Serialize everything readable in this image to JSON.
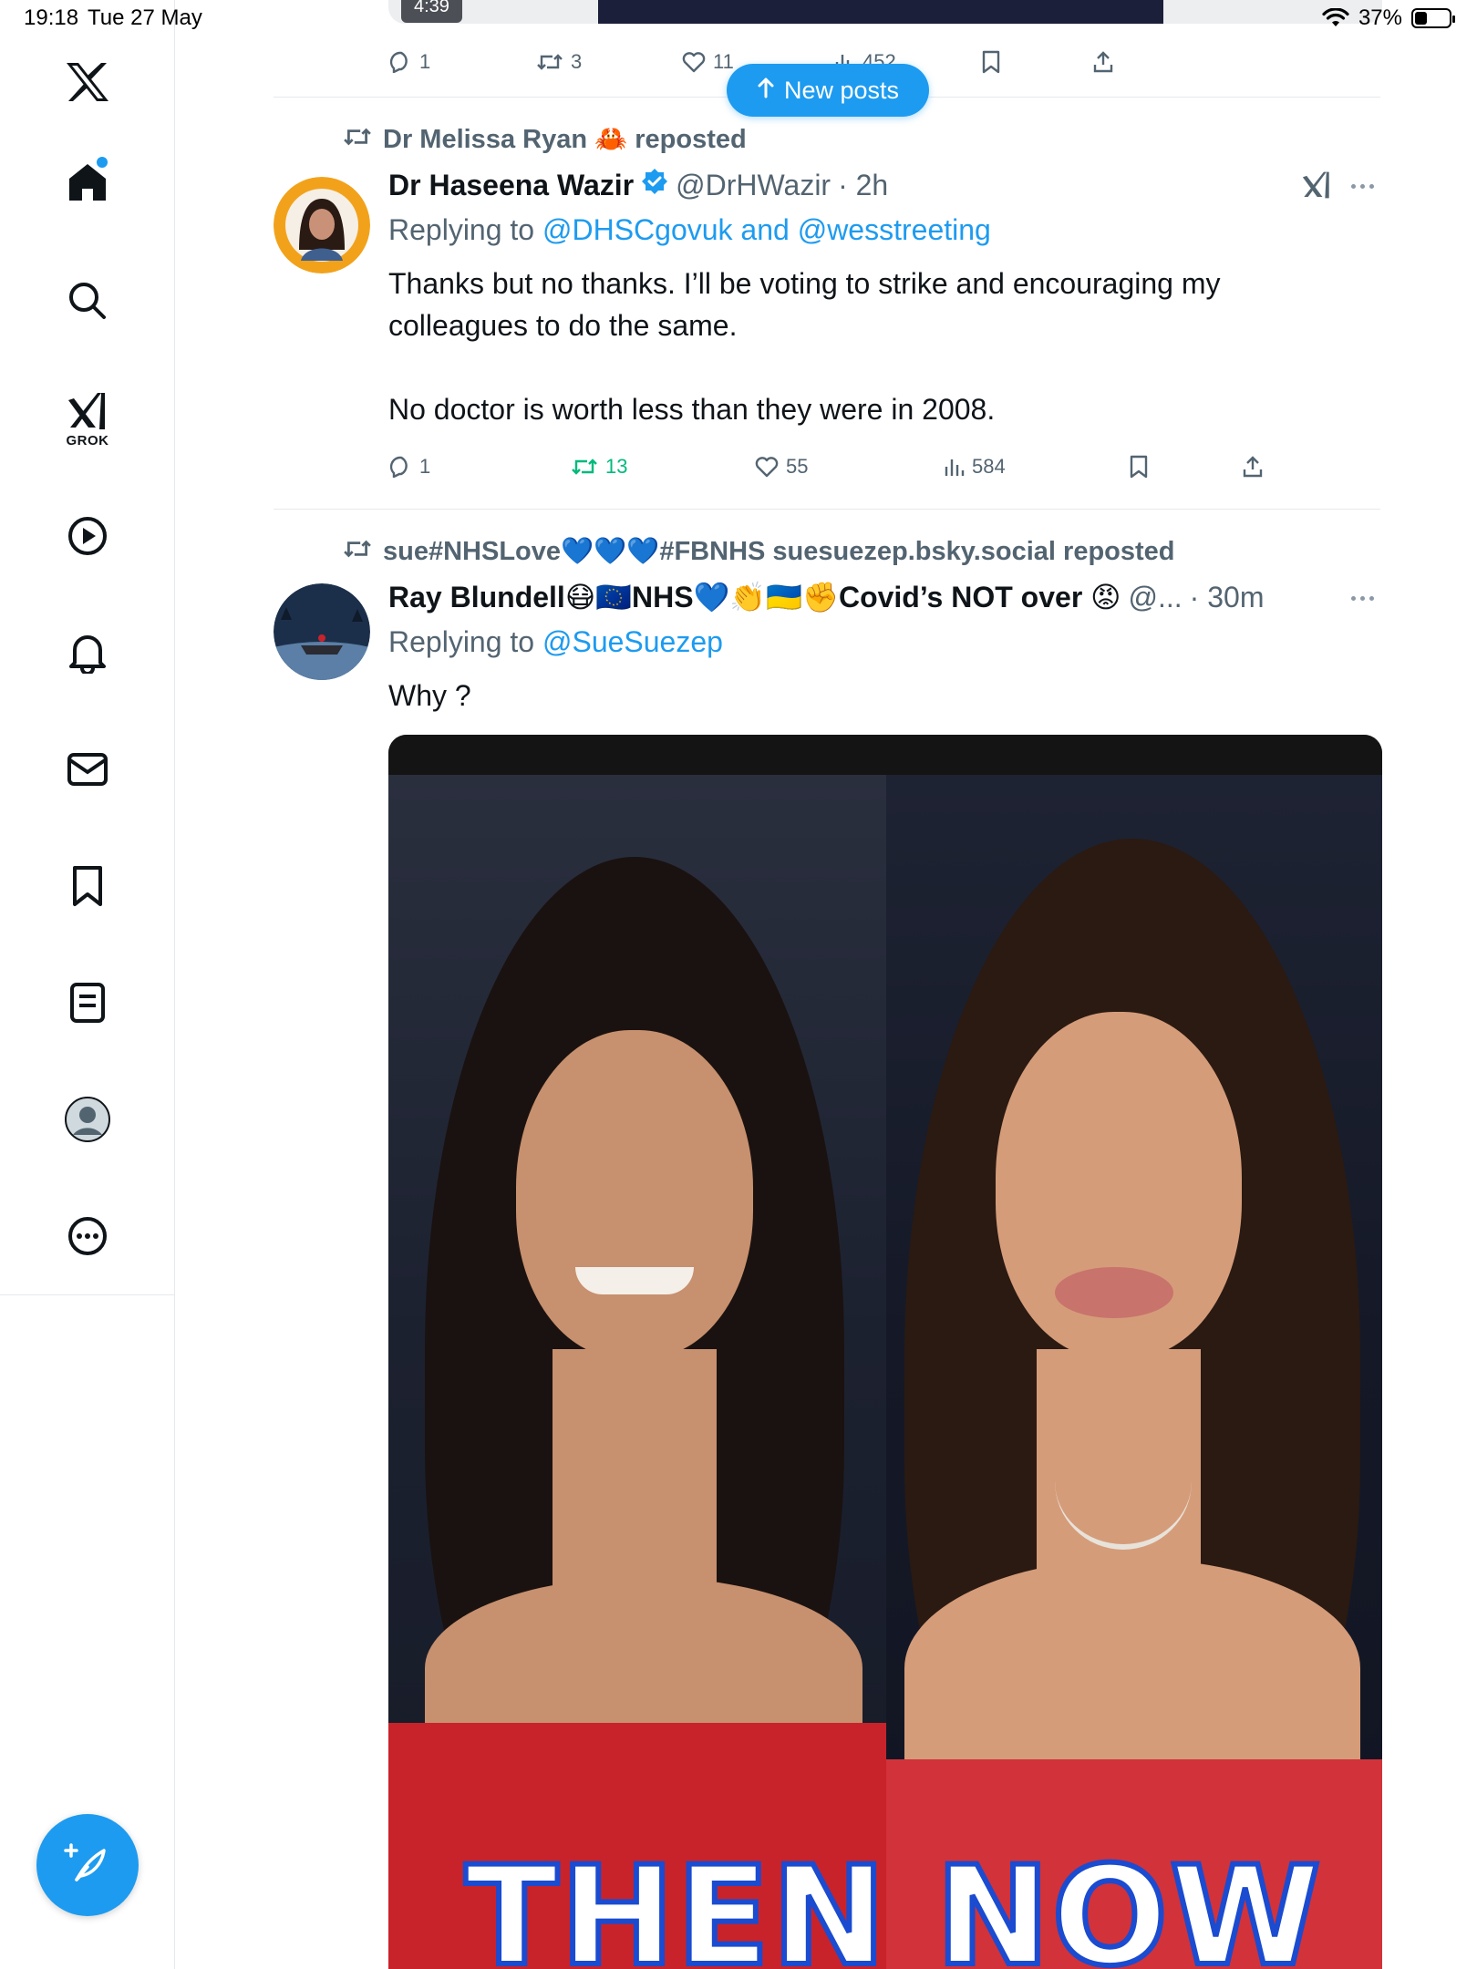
{
  "status_bar": {
    "time": "19:18",
    "date": "Tue 27 May",
    "battery": "37%",
    "battery_level": 0.37
  },
  "sidebar": {
    "items": [
      {
        "name": "x-logo",
        "label": ""
      },
      {
        "name": "home",
        "label": ""
      },
      {
        "name": "search",
        "label": ""
      },
      {
        "name": "grok",
        "label": "GROK"
      },
      {
        "name": "video",
        "label": ""
      },
      {
        "name": "notifications",
        "label": ""
      },
      {
        "name": "messages",
        "label": ""
      },
      {
        "name": "bookmarks",
        "label": ""
      },
      {
        "name": "lists",
        "label": ""
      },
      {
        "name": "profile",
        "label": ""
      },
      {
        "name": "more",
        "label": ""
      }
    ]
  },
  "new_posts": {
    "label": "New posts"
  },
  "top_post": {
    "duration": "4:39",
    "replies": "1",
    "reposts": "3",
    "likes": "11",
    "views": "452"
  },
  "tweets": [
    {
      "repost_by": "Dr Melissa Ryan 🦀 reposted",
      "name": "Dr Haseena Wazir",
      "verified": true,
      "handle": "@DrHWazir",
      "time": "· 2h",
      "replying_prefix": "Replying to",
      "replying_to": "@DHSCgovuk and @wesstreeting",
      "text_p1": "Thanks but no thanks. I’ll be voting to strike and encouraging my colleagues to do the same.",
      "text_p2": "No doctor is worth less than they were in 2008.",
      "replies": "1",
      "reposts": "13",
      "likes": "55",
      "views": "584"
    },
    {
      "repost_by": "sue#NHSLove💙💙💙#FBNHS suesuezep.bsky.social reposted",
      "name": "Ray Blundell😷🇪🇺NHS💙👏🇺🇦✊Covid’s NOT over 😡",
      "handle": "@...",
      "time": "· 30m",
      "replying_prefix": "Replying to",
      "replying_to": "@SueSuezep",
      "text": "Why ?",
      "media_caption_left": "THEN",
      "media_caption_right": "NOW"
    }
  ],
  "colors": {
    "accent": "#1d9bf0",
    "text": "#0f1419",
    "muted": "#536471",
    "repost_active": "#00ba7c",
    "divider": "#e6e9ec"
  }
}
